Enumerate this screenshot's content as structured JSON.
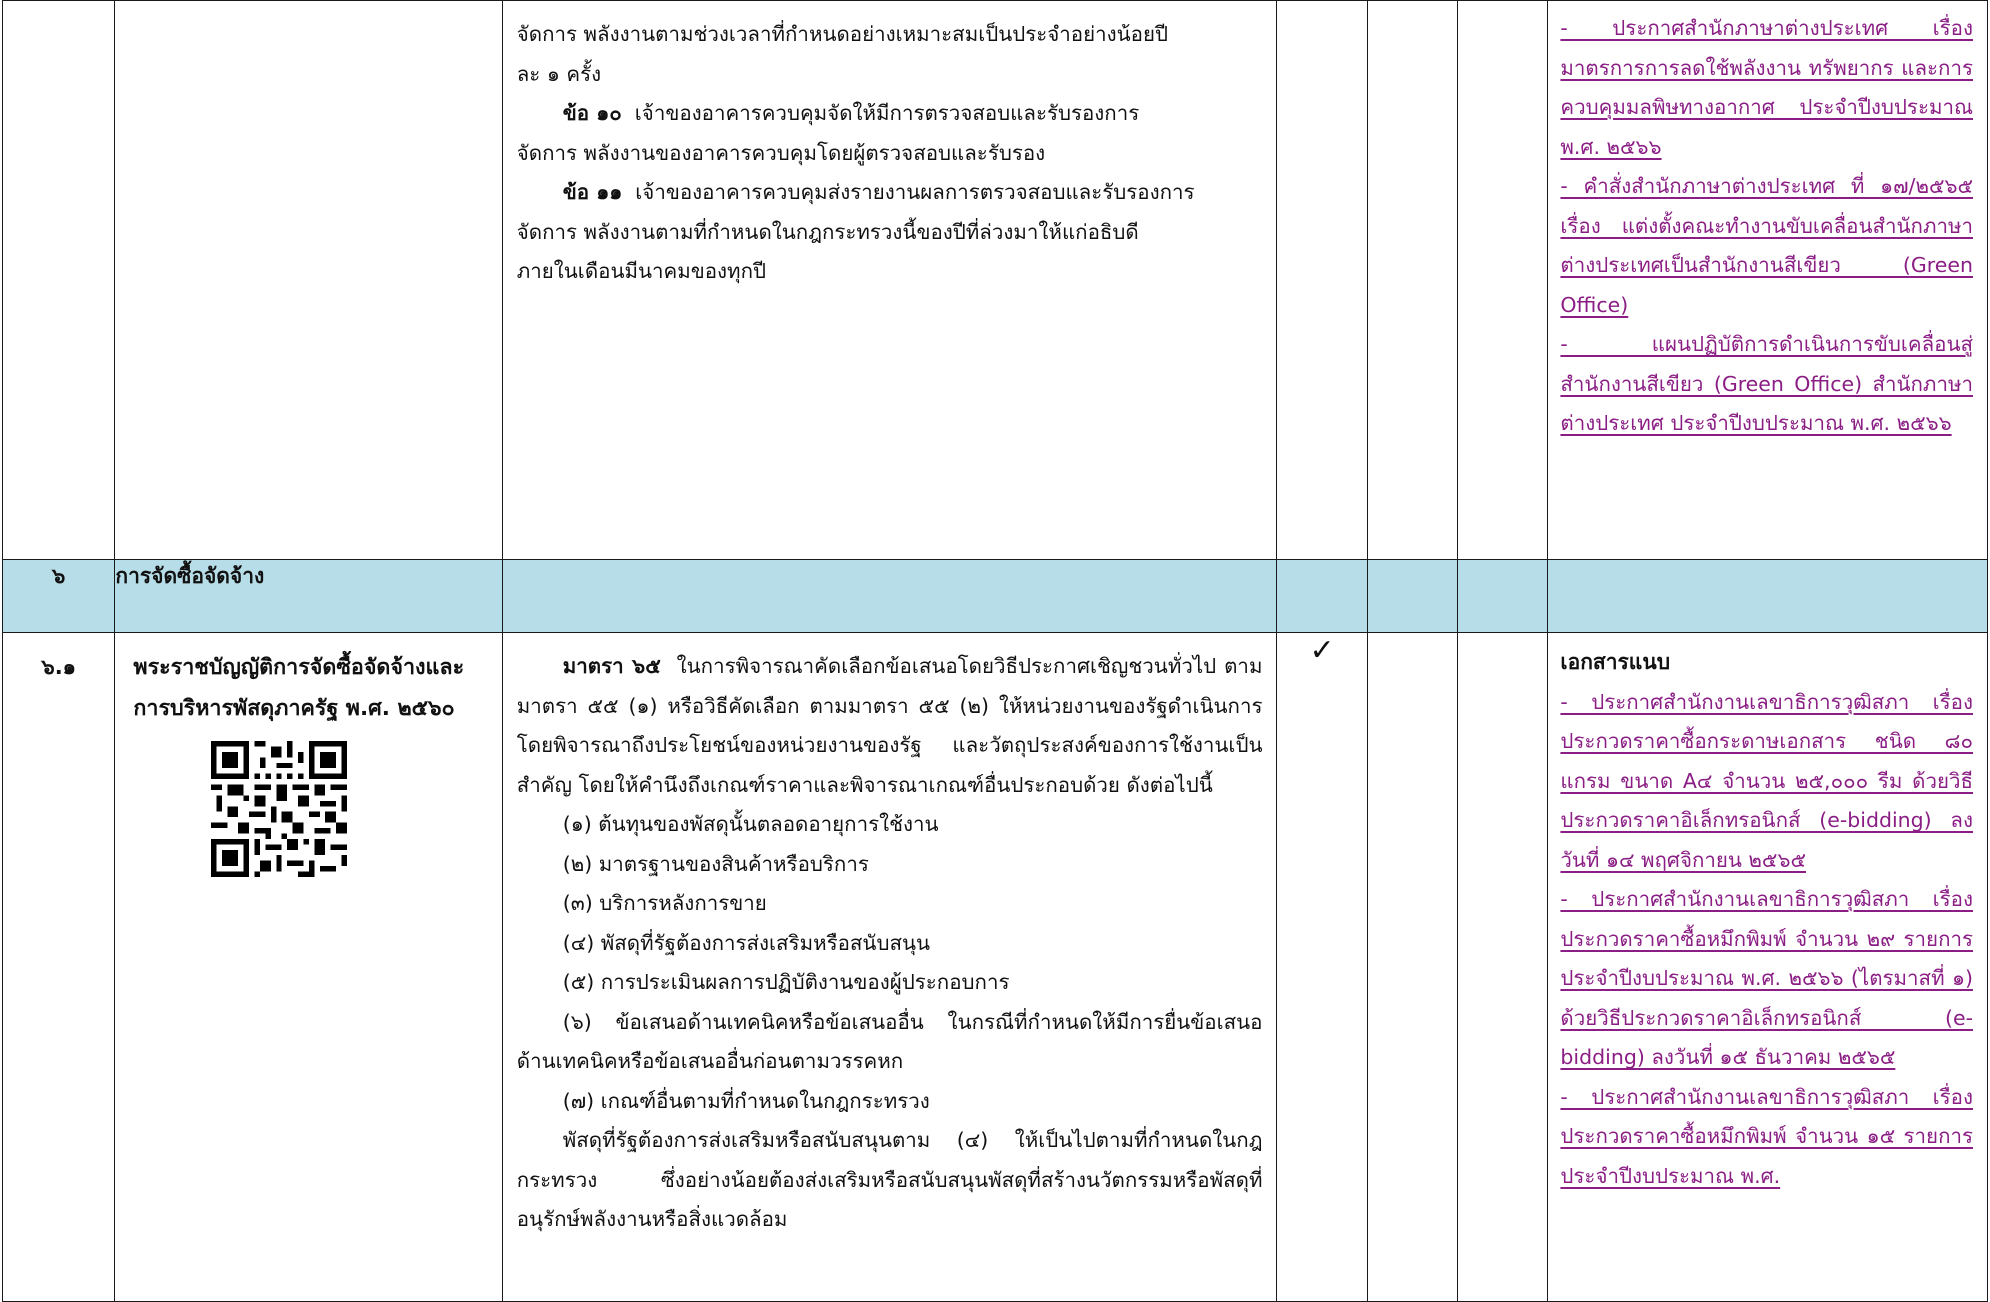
{
  "row1": {
    "lines": [
      "จัดการ พลังงานตามช่วงเวลาที่กำหนดอย่างเหมาะสมเป็นประจำอย่างน้อยปี",
      "ละ ๑ ครั้ง"
    ],
    "clause10_label": "ข้อ ๑๐",
    "clause10_text": "เจ้าของอาคารควบคุมจัดให้มีการตรวจสอบและรับรองการ",
    "clause10_cont": "จัดการ พลังงานของอาคารควบคุมโดยผู้ตรวจสอบและรับรอง",
    "clause11_label": "ข้อ ๑๑",
    "clause11_text": "เจ้าของอาคารควบคุมส่งรายงานผลการตรวจสอบและรับรองการ",
    "clause11_cont1": "จัดการ พลังงานตามที่กำหนดในกฎกระทรวงนี้ของปีที่ล่วงมาให้แก่อธิบดี",
    "clause11_cont2": "ภายในเดือนมีนาคมของทุกปี",
    "links": [
      "- ประกาศสำนักภาษาต่างประเทศ เรื่อง มาตรการการลดใช้พลังงาน ทรัพยากร และการควบคุมมลพิษทางอากาศ ประจำปีงบประมาณ พ.ศ. ๒๕๖๖",
      "- คำสั่งสำนักภาษาต่างประเทศ ที่ ๑๗/๒๕๖๕ เรื่อง แต่งตั้งคณะทำงานขับเคลื่อนสำนักภาษาต่างประเทศเป็นสำนักงานสีเขียว (Green Office)",
      "- แผนปฏิบัติการดำเนินการขับเคลื่อนสู่สำนักงานสีเขียว (Green Office) สำนักภาษาต่างประเทศ ประจำปีงบประมาณ พ.ศ. ๒๕๖๖"
    ]
  },
  "row2": {
    "number": "๖",
    "title": "การจัดซื้อจัดจ้าง"
  },
  "row3": {
    "number": "๖.๑",
    "law_title": "พระราชบัญญัติการจัดซื้อจัดจ้างและการบริหารพัสดุภาครัฐ พ.ศ. ๒๕๖๐",
    "section_label": "มาตรา ๖๕",
    "section_text": "ในการพิจารณาคัดเลือกข้อเสนอโดยวิธีประกาศเชิญชวนทั่วไป ตามมาตรา ๕๕ (๑) หรือวิธีคัดเลือก ตามมาตรา ๕๕ (๒) ให้หน่วยงานของรัฐดำเนินการโดยพิจารณาถึงประโยชน์ของหน่วยงานของรัฐ และวัตถุประสงค์ของการใช้งานเป็นสำคัญ โดยให้คำนึงถึงเกณฑ์ราคาและพิจารณาเกณฑ์อื่นประกอบด้วย ดังต่อไปนี้",
    "items": [
      "(๑) ต้นทุนของพัสดุนั้นตลอดอายุการใช้งาน",
      "(๒) มาตรฐานของสินค้าหรือบริการ",
      "(๓) บริการหลังการขาย",
      "(๔) พัสดุที่รัฐต้องการส่งเสริมหรือสนับสนุน",
      "(๕) การประเมินผลการปฏิบัติงานของผู้ประกอบการ"
    ],
    "item6": "(๖) ข้อเสนอด้านเทคนิคหรือข้อเสนออื่น ในกรณีที่กำหนดให้มีการยื่นข้อเสนอด้านเทคนิคหรือข้อเสนออื่นก่อนตามวรรคหก",
    "item7": "(๗) เกณฑ์อื่นตามที่กำหนดในกฎกระทรวง",
    "closing": "พัสดุที่รัฐต้องการส่งเสริมหรือสนับสนุนตาม (๔) ให้เป็นไปตามที่กำหนดในกฎกระทรวง ซึ่งอย่างน้อยต้องส่งเสริมหรือสนับสนุนพัสดุที่สร้างนวัตกรรมหรือพัสดุที่อนุรักษ์พลังงานหรือสิ่งแวดล้อม",
    "check": "✓",
    "attach_title": "เอกสารแนบ",
    "links": [
      "- ประกาศสำนักงานเลขาธิการวุฒิสภา เรื่อง ประกวดราคาซื้อกระดาษเอกสาร ชนิด ๘๐ แกรม ขนาด A๔ จำนวน ๒๕,๐๐๐ รีม ด้วยวิธีประกวดราคาอิเล็กทรอนิกส์ (e-bidding) ลงวันที่ ๑๔ พฤศจิกายน ๒๕๖๕",
      " - ประกาศสำนักงานเลขาธิการวุฒิสภา เรื่อง ประกวดราคาซื้อหมึกพิมพ์ จำนวน ๒๙ รายการ ประจำปีงบประมาณ พ.ศ. ๒๕๖๖ (ไตรมาสที่ ๑) ด้วยวิธีประกวดราคาอิเล็กทรอนิกส์ (e-bidding) ลงวันที่ ๑๕ ธันวาคม ๒๕๖๕",
      "- ประกาศสำนักงานเลขาธิการวุฒิสภา เรื่อง ประกวดราคาซื้อหมึกพิมพ์ จำนวน ๑๕ รายการ ประจำปีงบประมาณ พ.ศ."
    ]
  },
  "colors": {
    "header_row_bg": "#b7dde8",
    "link": "#8b1e85",
    "border": "#1a1a1a"
  },
  "icons": {
    "qr": "qr-code-icon",
    "check": "check-mark-icon"
  }
}
